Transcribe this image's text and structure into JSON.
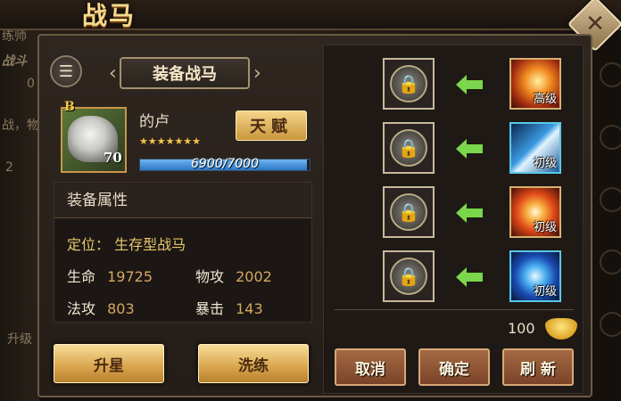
{
  "window": {
    "title": "战马"
  },
  "background": {
    "side_texts": [
      "练师",
      "战斗",
      "0",
      "战，物",
      "2",
      "升级"
    ]
  },
  "panel": {
    "section_title": "装备战马",
    "horse": {
      "grade": "B",
      "level": "70",
      "name": "的卢",
      "stars": "★★★★★★★",
      "star_count": 7,
      "exp_text": "6900/7000",
      "exp_fraction": 0.9857
    },
    "talent_button": "天赋",
    "attributes": {
      "header": "装备属性",
      "role_label": "定位：",
      "role_value": "生存型战马",
      "hp_label": "生命",
      "hp_value": "19725",
      "patk_label": "物攻",
      "patk_value": "2002",
      "matk_label": "法攻",
      "matk_value": "803",
      "crit_label": "暴击",
      "crit_value": "143"
    },
    "upgrade_button": "升星",
    "refine_button": "洗练"
  },
  "skills": {
    "rows": [
      {
        "level": "高级",
        "theme": "fire-slash"
      },
      {
        "level": "初级",
        "theme": "blue-wave"
      },
      {
        "level": "初级",
        "theme": "fire-burst"
      },
      {
        "level": "初级",
        "theme": "blue-vortex"
      }
    ],
    "gold_amount": "100",
    "cancel_button": "取消",
    "confirm_button": "确定",
    "refresh_button": "刷 新"
  },
  "icons": {
    "menu": "list-icon",
    "close": "close-icon",
    "lock": "lock-icon",
    "arrow": "arrow-left-icon",
    "gold": "gold-ingot-icon"
  },
  "colors": {
    "accent_gold": "#f5d48a",
    "exp_bar": "#4a9ae0",
    "arrow_green": "#7ad64a",
    "stat_value": "#d4a860"
  }
}
